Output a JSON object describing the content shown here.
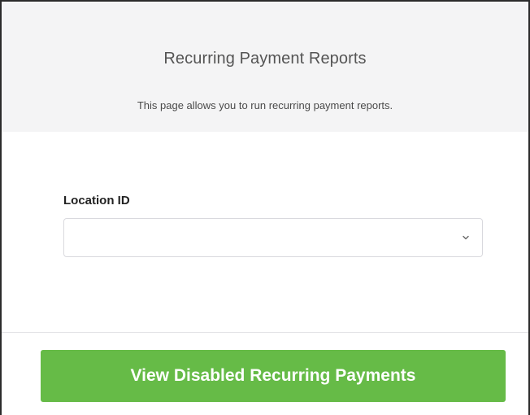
{
  "header": {
    "title": "Recurring Payment Reports",
    "description": "This page allows you to run recurring payment reports."
  },
  "form": {
    "location_label": "Location ID",
    "location_value": ""
  },
  "actions": {
    "view_disabled_label": "View Disabled Recurring Payments"
  },
  "colors": {
    "header_background": "#f4f4f5",
    "primary_button": "#66bb47",
    "primary_button_text": "#ffffff"
  },
  "icons": {
    "dropdown": "chevron-down-icon"
  }
}
